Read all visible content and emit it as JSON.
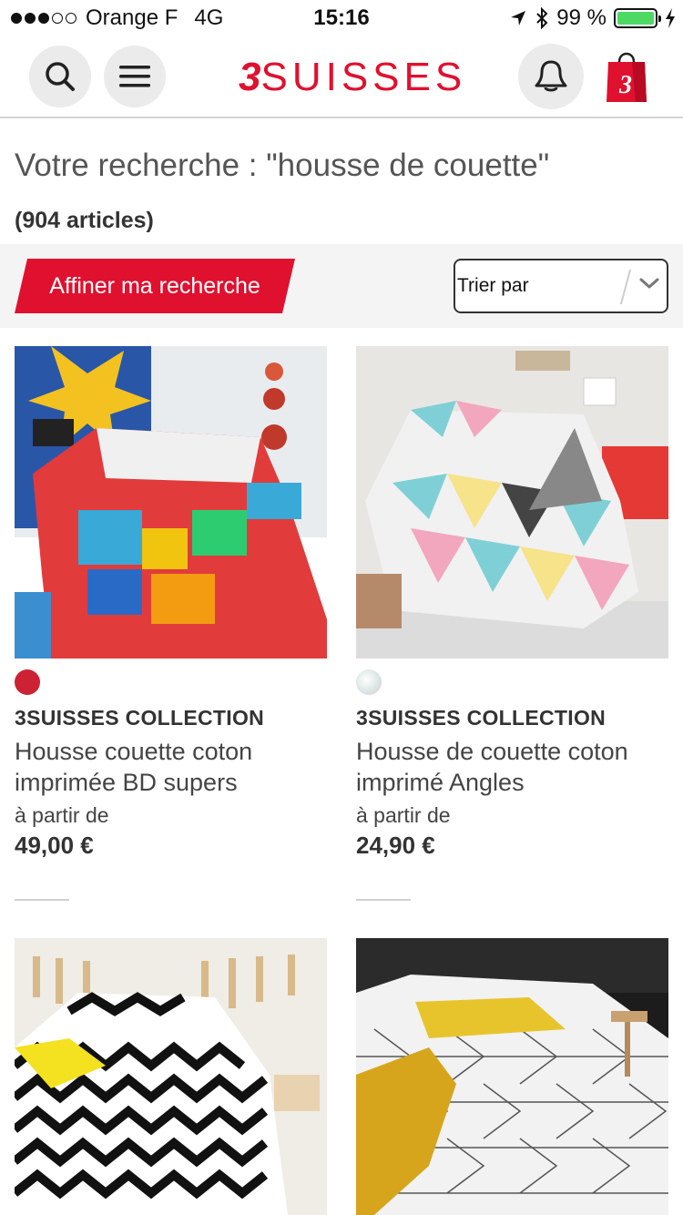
{
  "status_bar": {
    "carrier": "Orange F",
    "network": "4G",
    "time": "15:16",
    "battery": "99 %",
    "battery_level": 0.99
  },
  "header": {
    "logo_number": "3",
    "logo_text": "SUISSES",
    "icons": [
      "search-icon",
      "menu-icon",
      "account-icon",
      "shopping-bag-icon"
    ]
  },
  "search": {
    "title": "Votre recherche : \"housse de couette\"",
    "count": "(904 articles)"
  },
  "filters": {
    "refine_label": "Affiner ma recherche",
    "sort_label": "Trier par"
  },
  "products": [
    {
      "brand": "3SUISSES COLLECTION",
      "name_line1": "Housse couette coton",
      "name_line2": "imprimée BD supers",
      "from_label": "à partir de",
      "price": "49,00 €",
      "swatch_color": "#cc2233"
    },
    {
      "brand": "3SUISSES COLLECTION",
      "name_line1": "Housse de couette coton",
      "name_line2": "imprimé Angles",
      "from_label": "à partir de",
      "price": "24,90 €",
      "swatch_color": "#d8e4e2"
    },
    {},
    {}
  ],
  "colors": {
    "brand_red": "#e0102f",
    "filter_bg": "#f4f4f4"
  }
}
